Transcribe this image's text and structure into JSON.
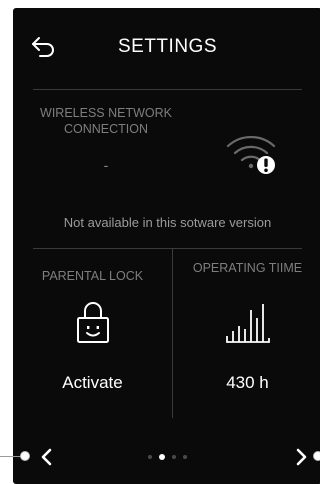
{
  "header": {
    "title": "SETTINGS",
    "back_icon": "back-arrow-icon"
  },
  "wireless": {
    "label": "WIRELESS NETWORK CONNECTION",
    "value": "-",
    "icon": "wifi-warning-icon",
    "note": "Not available in this sotware version"
  },
  "parental_lock": {
    "label": "PARENTAL LOCK",
    "icon": "lock-face-icon",
    "value": "Activate"
  },
  "operating_time": {
    "label": "OPERATING TIIME",
    "icon": "bar-chart-icon",
    "value": "430 h"
  },
  "pager": {
    "pages": 4,
    "active": 2,
    "prev_icon": "chevron-left-icon",
    "next_icon": "chevron-right-icon"
  },
  "colors": {
    "background": "#0a0a0a",
    "text": "#ffffff",
    "muted": "#7e7e7e",
    "divider": "#3a3a3a"
  }
}
